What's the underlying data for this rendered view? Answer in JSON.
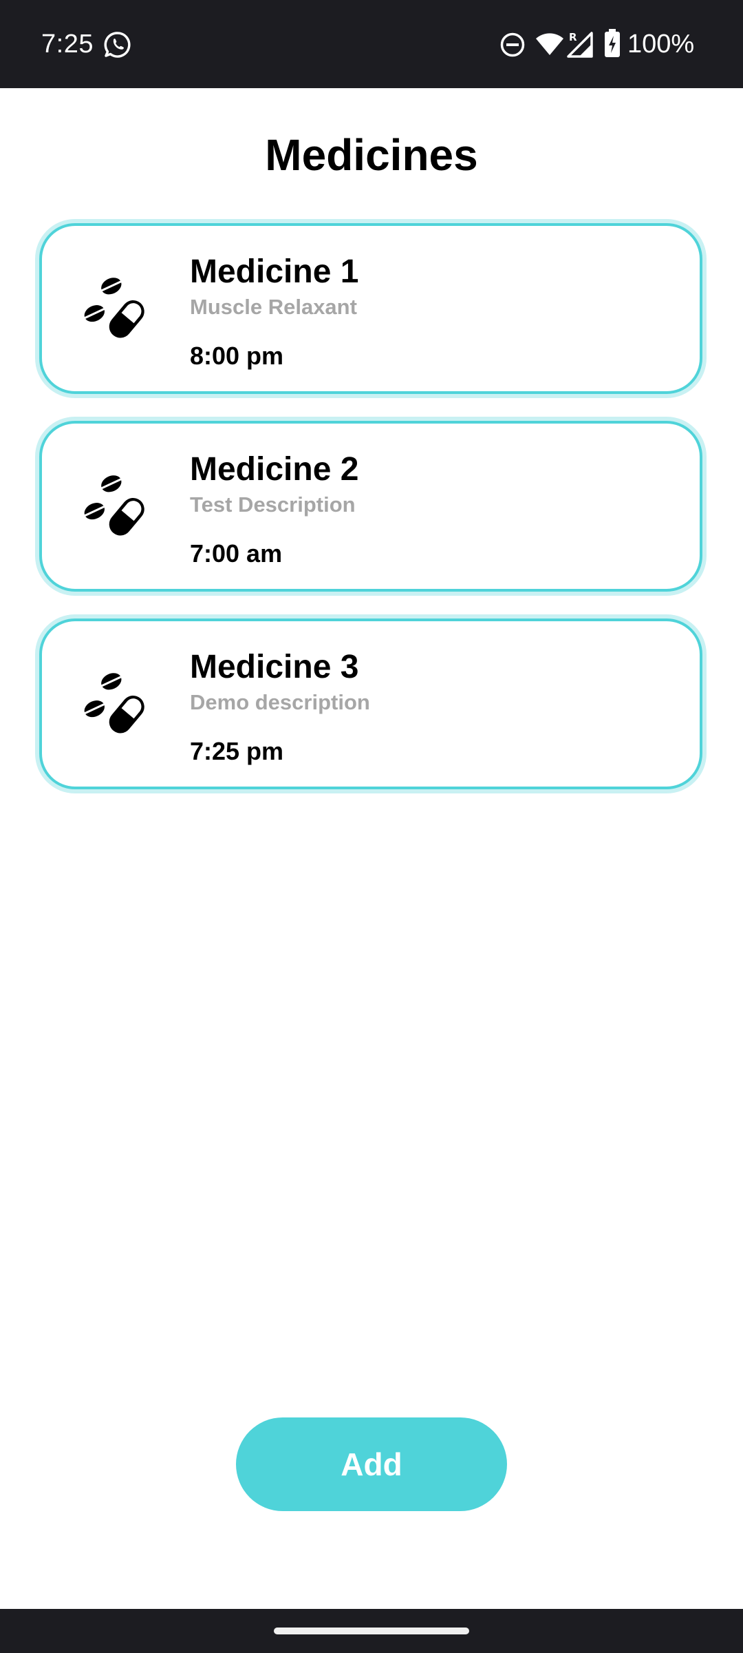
{
  "status_bar": {
    "time": "7:25",
    "battery": "100%",
    "icons": [
      "whatsapp-icon",
      "do-not-disturb-icon",
      "wifi-icon",
      "signal-roaming-icon",
      "battery-charging-icon"
    ]
  },
  "title": "Medicines",
  "medicines": [
    {
      "name": "Medicine 1",
      "description": "Muscle Relaxant",
      "time": "8:00 pm",
      "icon": "pills-icon"
    },
    {
      "name": "Medicine 2",
      "description": "Test Description",
      "time": "7:00 am",
      "icon": "pills-icon"
    },
    {
      "name": "Medicine 3",
      "description": "Demo description",
      "time": "7:25 pm",
      "icon": "pills-icon"
    }
  ],
  "add_button": {
    "label": "Add"
  },
  "colors": {
    "accent": "#4fd3d9",
    "card_glow": "#c9f1f3",
    "system_bar": "#1c1c21",
    "description_text": "#a6a6a6"
  }
}
